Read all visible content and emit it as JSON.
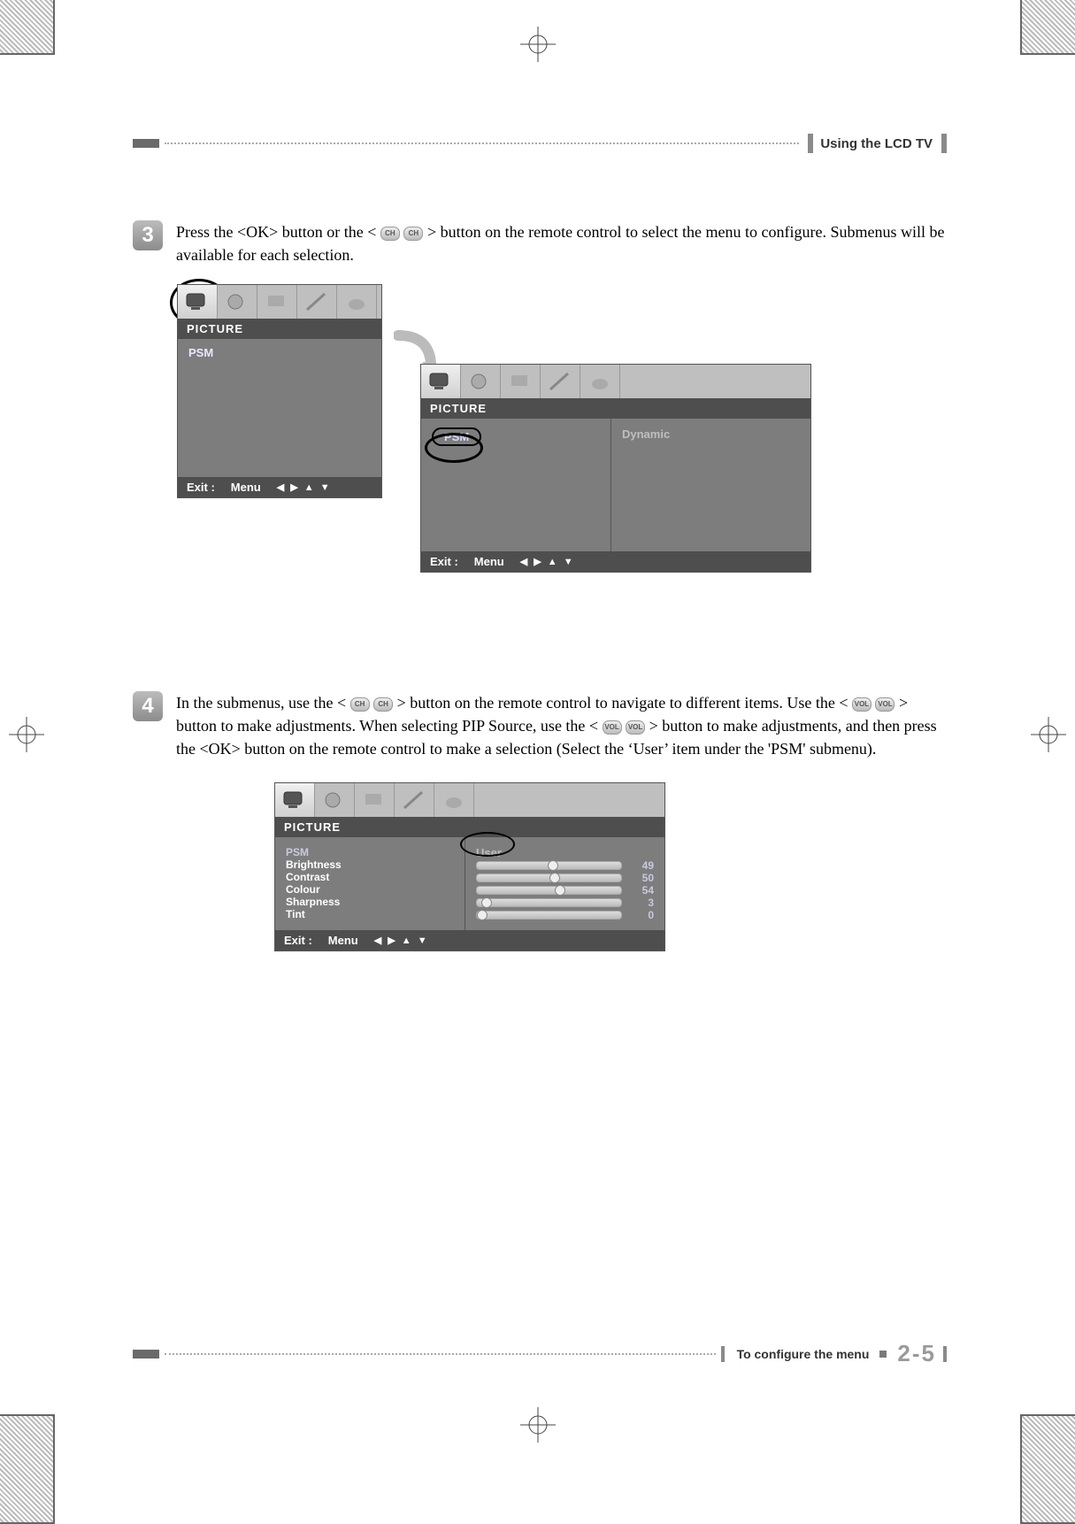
{
  "header": {
    "section_title": "Using the LCD TV"
  },
  "footer": {
    "section_title": "To configure the menu",
    "page_number": "2-5"
  },
  "steps": {
    "s3": {
      "number": "3",
      "text_parts": [
        "Press the <OK> button or the < ",
        " > button on the remote control to select the menu to configure. Submenus will be available for each selection."
      ],
      "btn1": "CH",
      "btn2": "CH"
    },
    "s4": {
      "number": "4",
      "text_parts": [
        "In the submenus, use the < ",
        " > button on the remote control to navigate to different items. Use the < ",
        " > button to make adjustments. When selecting PIP Source, use the < ",
        " > button to make adjustments, and then press the <OK> button on the remote control to make a selection (Select the ‘User’ item under the 'PSM' submenu)."
      ],
      "btn_ch1": "CH",
      "btn_ch2": "CH",
      "btn_vol1": "VOL",
      "btn_vol2": "VOL",
      "btn_vol3": "VOL",
      "btn_vol4": "VOL"
    }
  },
  "osd_common": {
    "title": "PICTURE",
    "footer_exit": "Exit :",
    "footer_menu": "Menu",
    "arrows": "◀ ▶ ▲ ▼"
  },
  "osd1": {
    "item": "PSM"
  },
  "osd2": {
    "item": "PSM",
    "value": "Dynamic"
  },
  "osd3": {
    "rows": [
      {
        "label": "PSM",
        "value_text": "User",
        "is_psm": true
      },
      {
        "label": "Brightness",
        "value": 49
      },
      {
        "label": "Contrast",
        "value": 50
      },
      {
        "label": "Colour",
        "value": 54
      },
      {
        "label": "Sharpness",
        "value": 3
      },
      {
        "label": "Tint",
        "value": 0
      }
    ]
  }
}
